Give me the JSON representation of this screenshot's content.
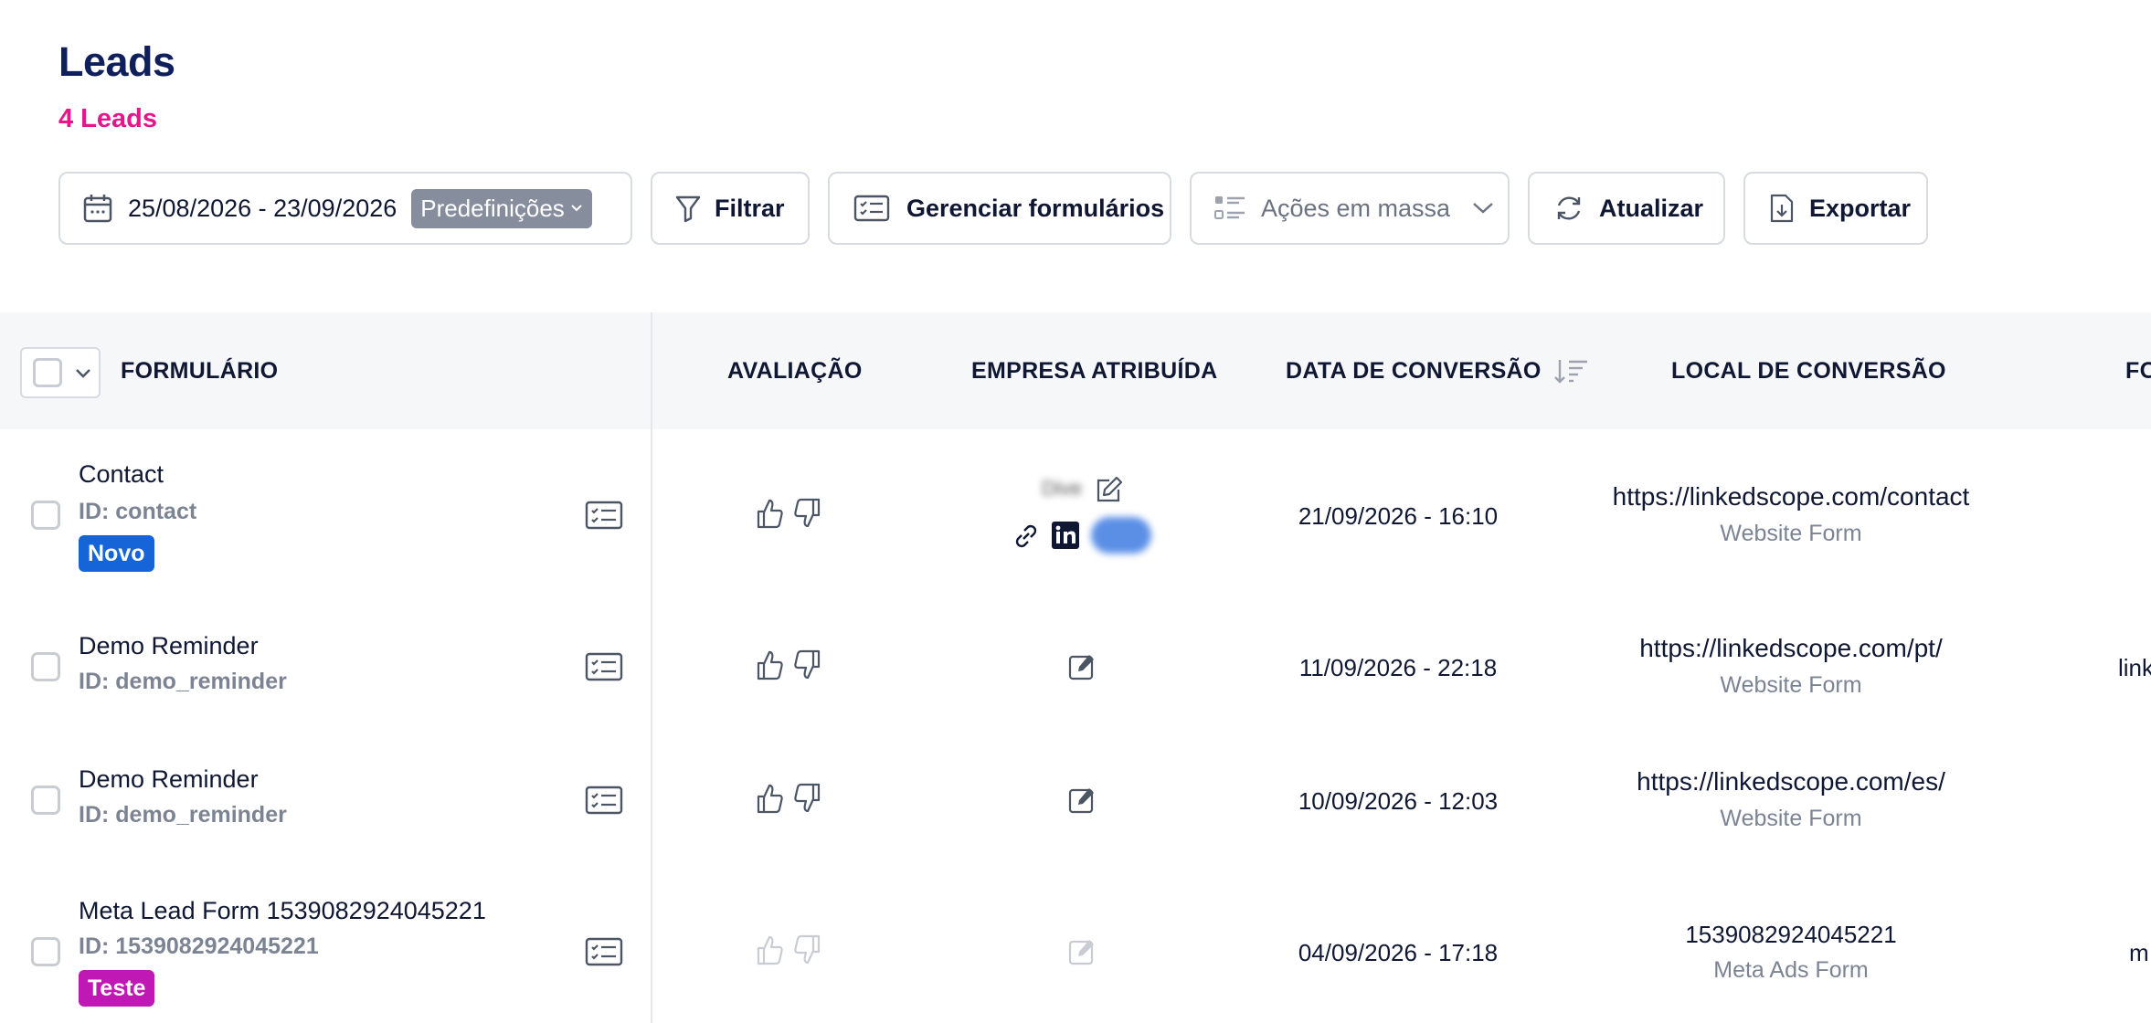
{
  "page": {
    "title": "Leads",
    "count": "4 Leads"
  },
  "toolbar": {
    "date_range": "25/08/2026 - 23/09/2026",
    "presets_label": "Predefinições",
    "filter_label": "Filtrar",
    "manage_forms_label": "Gerenciar formulários",
    "bulk_actions_label": "Ações em massa",
    "refresh_label": "Atualizar",
    "export_label": "Exportar"
  },
  "table": {
    "columns": {
      "form": "FORMULÁRIO",
      "rating": "AVALIAÇÃO",
      "company": "EMPRESA ATRIBUÍDA",
      "conversion_date": "DATA DE CONVERSÃO",
      "conversion_location": "LOCAL DE CONVERSÃO",
      "next": "FO"
    },
    "rows": [
      {
        "name": "Contact",
        "id": "ID: contact",
        "badge": "Novo",
        "badge_color": "#1665d8",
        "company": "Dive",
        "date": "21/09/2026 - 16:10",
        "location": "https://linkedscope.com/contact",
        "source": "Website Form",
        "extra": ""
      },
      {
        "name": "Demo Reminder",
        "id": "ID: demo_reminder",
        "badge": "",
        "date": "11/09/2026 - 22:18",
        "location": "https://linkedscope.com/pt/",
        "source": "Website Form",
        "extra": "link"
      },
      {
        "name": "Demo Reminder",
        "id": "ID: demo_reminder",
        "badge": "",
        "date": "10/09/2026 - 12:03",
        "location": "https://linkedscope.com/es/",
        "source": "Website Form",
        "extra": ""
      },
      {
        "name": "Meta Lead Form 1539082924045221",
        "id": "ID: 1539082924045221",
        "badge": "Teste",
        "badge_color": "#c018b4",
        "date": "04/09/2026 - 17:18",
        "location": "1539082924045221",
        "source": "Meta Ads Form",
        "extra": "m"
      }
    ]
  }
}
